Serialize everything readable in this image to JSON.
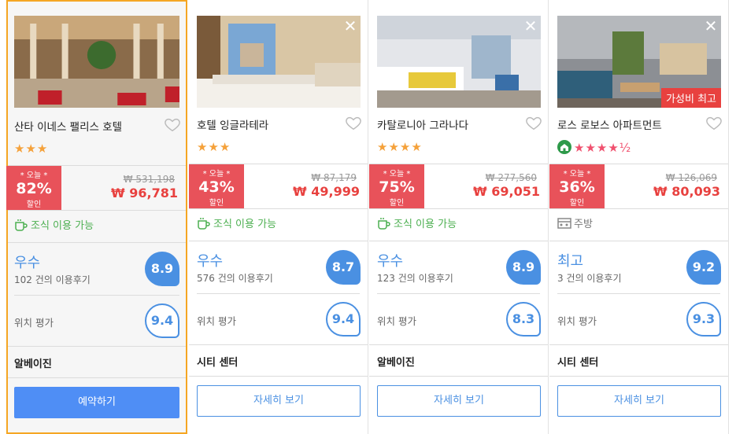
{
  "hotels": [
    {
      "name": "산타 이네스 팰리스 호텔",
      "stars": "★★★",
      "star_color": "orange",
      "show_home_icon": false,
      "discount_today": "* 오늘 *",
      "discount_pct": "82%",
      "discount_label": "할인",
      "old_price": "₩ 531,198",
      "new_price": "₩ 96,781",
      "amenity": "조식 이용 가능",
      "amenity_icon": "coffee-cup-icon",
      "rating_word": "우수",
      "reviews": "102 건의 이용후기",
      "score": "8.9",
      "location_label": "위치 평가",
      "location_score": "9.4",
      "district": "알베이진",
      "button": "예약하기",
      "badge": "",
      "selected": true,
      "close": false
    },
    {
      "name": "호텔 잉글라테라",
      "stars": "★★★",
      "star_color": "orange",
      "show_home_icon": false,
      "discount_today": "* 오늘 *",
      "discount_pct": "43%",
      "discount_label": "할인",
      "old_price": "₩ 87,179",
      "new_price": "₩ 49,999",
      "amenity": "조식 이용 가능",
      "amenity_icon": "coffee-cup-icon",
      "rating_word": "우수",
      "reviews": "576 건의 이용후기",
      "score": "8.7",
      "location_label": "위치 평가",
      "location_score": "9.4",
      "district": "시티 센터",
      "button": "자세히 보기",
      "badge": "",
      "selected": false,
      "close": true
    },
    {
      "name": "카탈로니아 그라나다",
      "stars": "★★★★",
      "star_color": "orange",
      "show_home_icon": false,
      "discount_today": "* 오늘 *",
      "discount_pct": "75%",
      "discount_label": "할인",
      "old_price": "₩ 277,560",
      "new_price": "₩ 69,051",
      "amenity": "조식 이용 가능",
      "amenity_icon": "coffee-cup-icon",
      "rating_word": "우수",
      "reviews": "123 건의 이용후기",
      "score": "8.9",
      "location_label": "위치 평가",
      "location_score": "8.3",
      "district": "알베이진",
      "button": "자세히 보기",
      "badge": "",
      "selected": false,
      "close": true
    },
    {
      "name": "로스 로보스 아파트먼트",
      "stars": "★★★★½",
      "star_color": "pink",
      "show_home_icon": true,
      "discount_today": "* 오늘 *",
      "discount_pct": "36%",
      "discount_label": "할인",
      "old_price": "₩ 126,069",
      "new_price": "₩ 80,093",
      "amenity": "주방",
      "amenity_icon": "kitchen-icon",
      "rating_word": "최고",
      "reviews": "3 건의 이용후기",
      "score": "9.2",
      "location_label": "위치 평가",
      "location_score": "9.3",
      "district": "시티 센터",
      "button": "자세히 보기",
      "badge": "가성비 최고",
      "selected": false,
      "close": true
    }
  ]
}
